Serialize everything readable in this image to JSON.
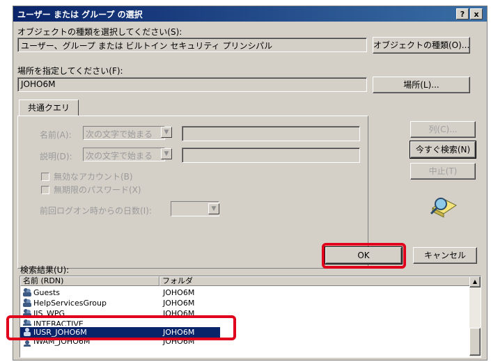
{
  "title": "ユーザー または グループ の選択",
  "titlebar_buttons": {
    "help": "?",
    "close": "x"
  },
  "object_type": {
    "label": "オブジェクトの種類を選択してください(S):",
    "value": "ユーザー、グループ または ビルトイン セキュリティ プリンシパル",
    "button": "オブジェクトの種類(O)..."
  },
  "location": {
    "label": "場所を指定してください(F):",
    "value": "JOHO6M",
    "button": "場所(L)..."
  },
  "tab": {
    "label": "共通クエリ"
  },
  "query": {
    "name_label": "名前(A):",
    "name_mode": "次の文字で始まる",
    "desc_label": "説明(D):",
    "desc_mode": "次の文字で始まる",
    "disabled_accounts": "無効なアカウント(B)",
    "nonexpiring_password": "無期限のパスワード(X)",
    "last_logon_label": "前回ログオン時からの日数(I):"
  },
  "side_buttons": {
    "columns": "列(C)...",
    "search_now": "今すぐ検索(N)",
    "stop": "中止(T)"
  },
  "ok_button": "OK",
  "cancel_button": "キャンセル",
  "results": {
    "label": "検索結果(U):",
    "columns": [
      "名前 (RDN)",
      "フォルダ"
    ],
    "rows": [
      {
        "name": "Guests",
        "folder": "JOHO6M"
      },
      {
        "name": "HelpServicesGroup",
        "folder": "JOHO6M"
      },
      {
        "name": "IIS_WPG",
        "folder": "JOHO6M"
      },
      {
        "name": "INTERACTIVE",
        "folder": ""
      },
      {
        "name": "IUSR_JOHO6M",
        "folder": "JOHO6M",
        "selected": true
      },
      {
        "name": "IWAM_JOHO6M",
        "folder": "JOHO6M"
      }
    ]
  },
  "colors": {
    "selection": "#0a246a",
    "highlight": "#e0001b",
    "face": "#d4d0c8"
  }
}
